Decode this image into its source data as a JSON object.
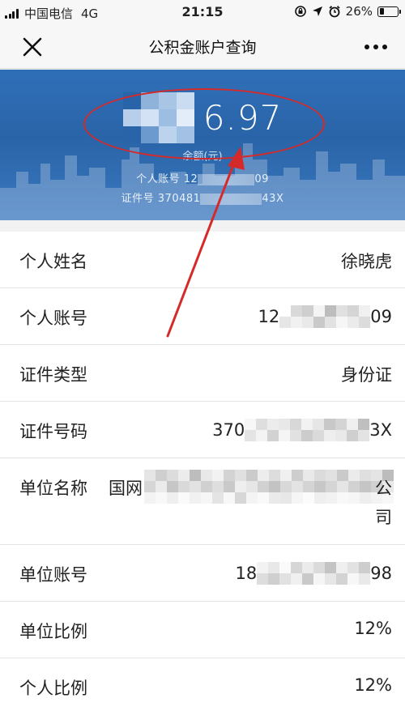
{
  "status": {
    "carrier": "中国电信",
    "network": "4G",
    "time": "21:15",
    "battery": "26%",
    "battery_level": 0.26
  },
  "nav": {
    "title": "公积金账户查询",
    "close_icon": "close-icon",
    "more_icon": "more-icon"
  },
  "account": {
    "balance_visible": "6.97",
    "balance_label": "余额(元)",
    "account_line_prefix": "个人账号 12",
    "account_line_suffix": "09",
    "id_line_prefix": "证件号 370481",
    "id_line_suffix": "43X"
  },
  "details": [
    {
      "label": "个人姓名",
      "value": "徐晓虎"
    },
    {
      "label": "个人账号",
      "value_prefix": "12",
      "value_suffix": "09"
    },
    {
      "label": "证件类型",
      "value": "身份证"
    },
    {
      "label": "证件号码",
      "value_prefix": "370",
      "value_suffix": "3X"
    },
    {
      "label": "单位名称",
      "value_prefix": "国网",
      "value_tail_1": "公",
      "value_tail_2": "司"
    },
    {
      "label": "单位账号",
      "value_prefix": "18",
      "value_suffix": "98"
    },
    {
      "label": "单位比例",
      "value": "12%"
    },
    {
      "label": "个人比例",
      "value": "12%"
    }
  ],
  "colors": {
    "banner": "#2a64a8",
    "annotation_red": "#d42a2a"
  }
}
